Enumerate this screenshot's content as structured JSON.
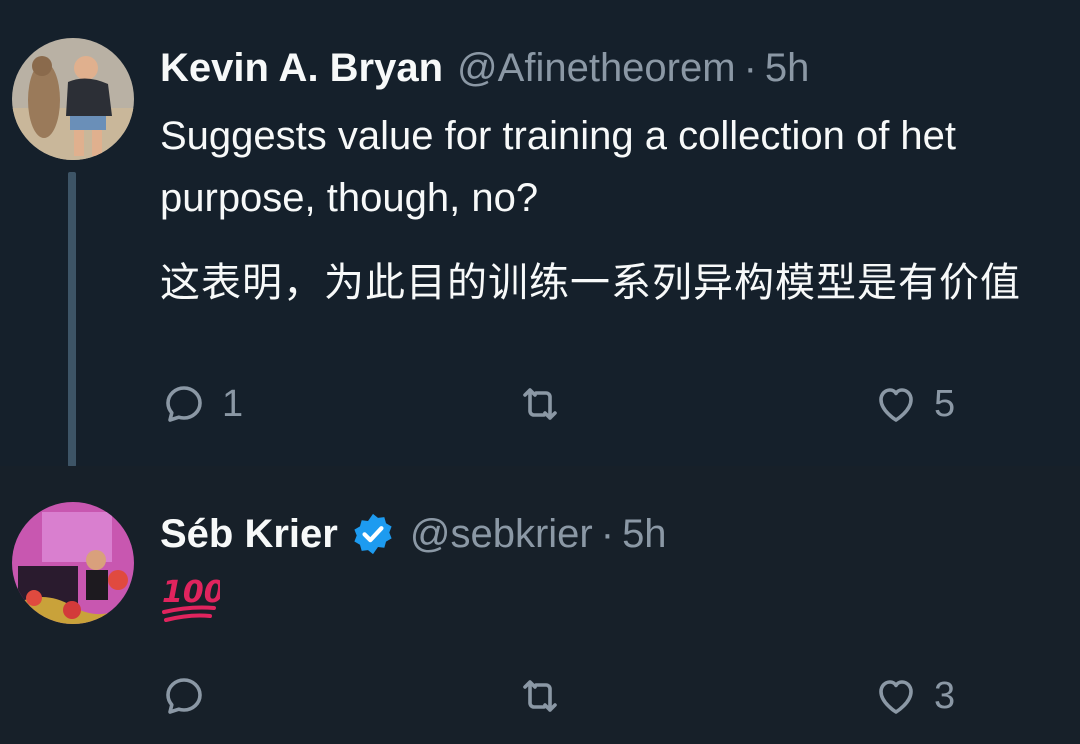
{
  "tweets": [
    {
      "author": {
        "name": "Kevin A. Bryan",
        "handle": "@Afinetheorem",
        "verified": false
      },
      "time": "5h",
      "text_lines": [
        "Suggests value for training a collection of het",
        "purpose, though, no?"
      ],
      "translation": "这表明，为此目的训练一系列异构模型是有价值",
      "stats": {
        "replies": "1",
        "retweets": "",
        "likes": "5"
      }
    },
    {
      "author": {
        "name": "Séb Krier",
        "handle": "@sebkrier",
        "verified": true
      },
      "time": "5h",
      "text": "💯",
      "stats": {
        "replies": "",
        "retweets": "",
        "likes": "3"
      }
    }
  ],
  "separator": "·",
  "icons": {
    "reply": "reply-icon",
    "retweet": "retweet-icon",
    "like": "heart-icon",
    "verified": "verified-badge-icon",
    "hundred": "hundred-points-icon"
  },
  "colors": {
    "background": "#15202b",
    "text": "#f7f9f9",
    "muted": "#8b98a5",
    "verified": "#1d9bf0",
    "hundred": "#e0245e"
  }
}
